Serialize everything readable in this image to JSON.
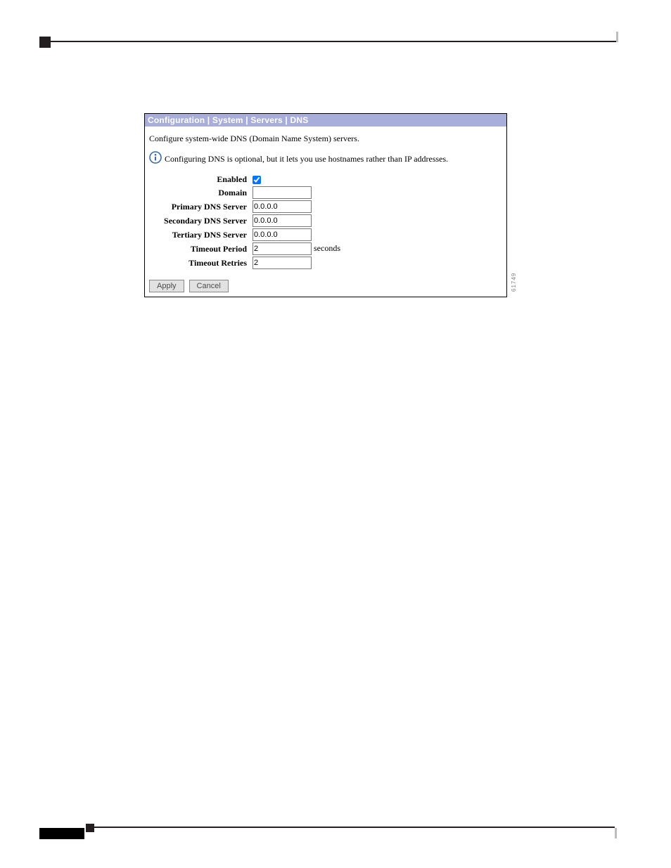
{
  "panel": {
    "breadcrumb": "Configuration | System | Servers | DNS",
    "description": "Configure system-wide DNS (Domain Name System) servers.",
    "note": "Configuring DNS is optional, but it lets you use hostnames rather than IP addresses."
  },
  "fields": {
    "enabled": {
      "label": "Enabled",
      "checked": true
    },
    "domain": {
      "label": "Domain",
      "value": ""
    },
    "primary": {
      "label": "Primary DNS Server",
      "value": "0.0.0.0"
    },
    "secondary": {
      "label": "Secondary DNS Server",
      "value": "0.0.0.0"
    },
    "tertiary": {
      "label": "Tertiary DNS Server",
      "value": "0.0.0.0"
    },
    "timeout_period": {
      "label": "Timeout Period",
      "value": "2",
      "suffix": "seconds"
    },
    "timeout_retries": {
      "label": "Timeout Retries",
      "value": "2"
    }
  },
  "buttons": {
    "apply": "Apply",
    "cancel": "Cancel"
  },
  "figure_id": "61749"
}
